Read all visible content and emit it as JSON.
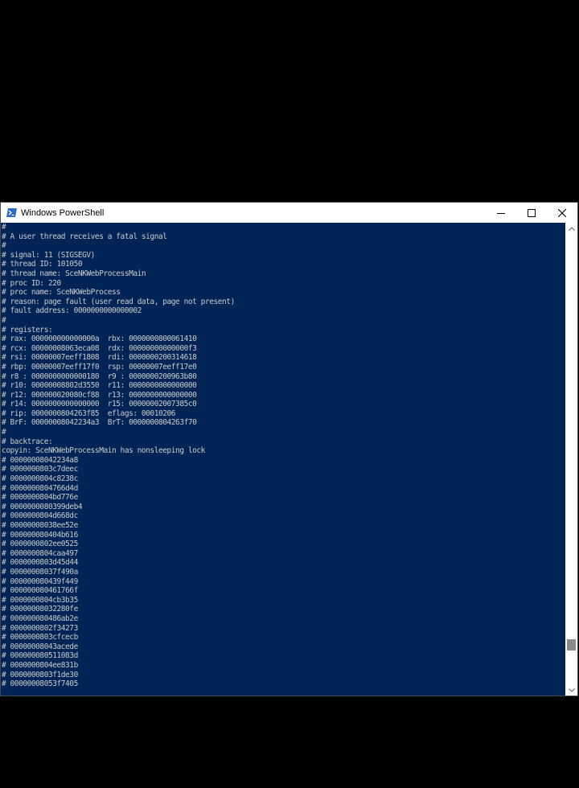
{
  "window": {
    "title": "Windows PowerShell",
    "icons": {
      "app": "powershell-icon",
      "minimize": "minimize-icon",
      "maximize": "maximize-icon",
      "close": "close-icon"
    }
  },
  "console": {
    "lines": [
      "#",
      "# A user thread receives a fatal signal",
      "#",
      "# signal: 11 (SIGSEGV)",
      "# thread ID: 101050",
      "# thread name: SceNKWebProcessMain",
      "# proc ID: 220",
      "# proc name: SceNKWebProcess",
      "# reason: page fault (user read data, page not present)",
      "# fault address: 0000000000000002",
      "#",
      "# registers:",
      "# rax: 000000000000000a  rbx: 0000000800061410",
      "# rcx: 00000008063eca08  rdx: 00000000000000f3",
      "# rsi: 00000007eeff1808  rdi: 0000000200314618",
      "# rbp: 00000007eeff17f0  rsp: 00000007eeff17e0",
      "# r8 : 0000000000000180  r9 : 0000000200963b80",
      "# r10: 00000008802d3550  r11: 0000000000000000",
      "# r12: 000000020080cf88  r13: 0000000000000000",
      "# r14: 0000000000000000  r15: 00000002007385c0",
      "# rip: 0000000804263f85  eflags: 00010206",
      "# BrF: 00000008042234a3  BrT: 0000000804263f70",
      "#",
      "# backtrace:",
      "copyin: SceNKWebProcessMain has nonsleeping lock",
      "# 00000008042234a8",
      "# 0000000803c7deec",
      "# 0000000804c8238c",
      "# 0000000804766d4d",
      "# 0000000804bd776e",
      "# 0000000080399deb4",
      "# 0000000804d668dc",
      "# 00000008038ee52e",
      "# 000000080404b616",
      "# 0000000802ee0525",
      "# 0000000804caa497",
      "# 0000000803d45d44",
      "# 00000008037f490a",
      "# 000000080439f449",
      "# 000000080461766f",
      "# 0000000804cb3b35",
      "# 00000008032280fe",
      "# 000000080486ab2e",
      "# 0000000802f34273",
      "# 0000000803cfcecb",
      "# 00000008043acede",
      "# 000000080511083d",
      "# 0000000804ee831b",
      "# 0000000803f1de30",
      "# 00000008053f7405"
    ]
  },
  "scrollbar": {
    "up_icon": "scroll-up-icon",
    "down_icon": "scroll-down-icon"
  },
  "colors": {
    "console_bg": "#012456",
    "console_text": "#cccccc",
    "titlebar_bg": "#ffffff",
    "outer_bg": "#000000"
  }
}
